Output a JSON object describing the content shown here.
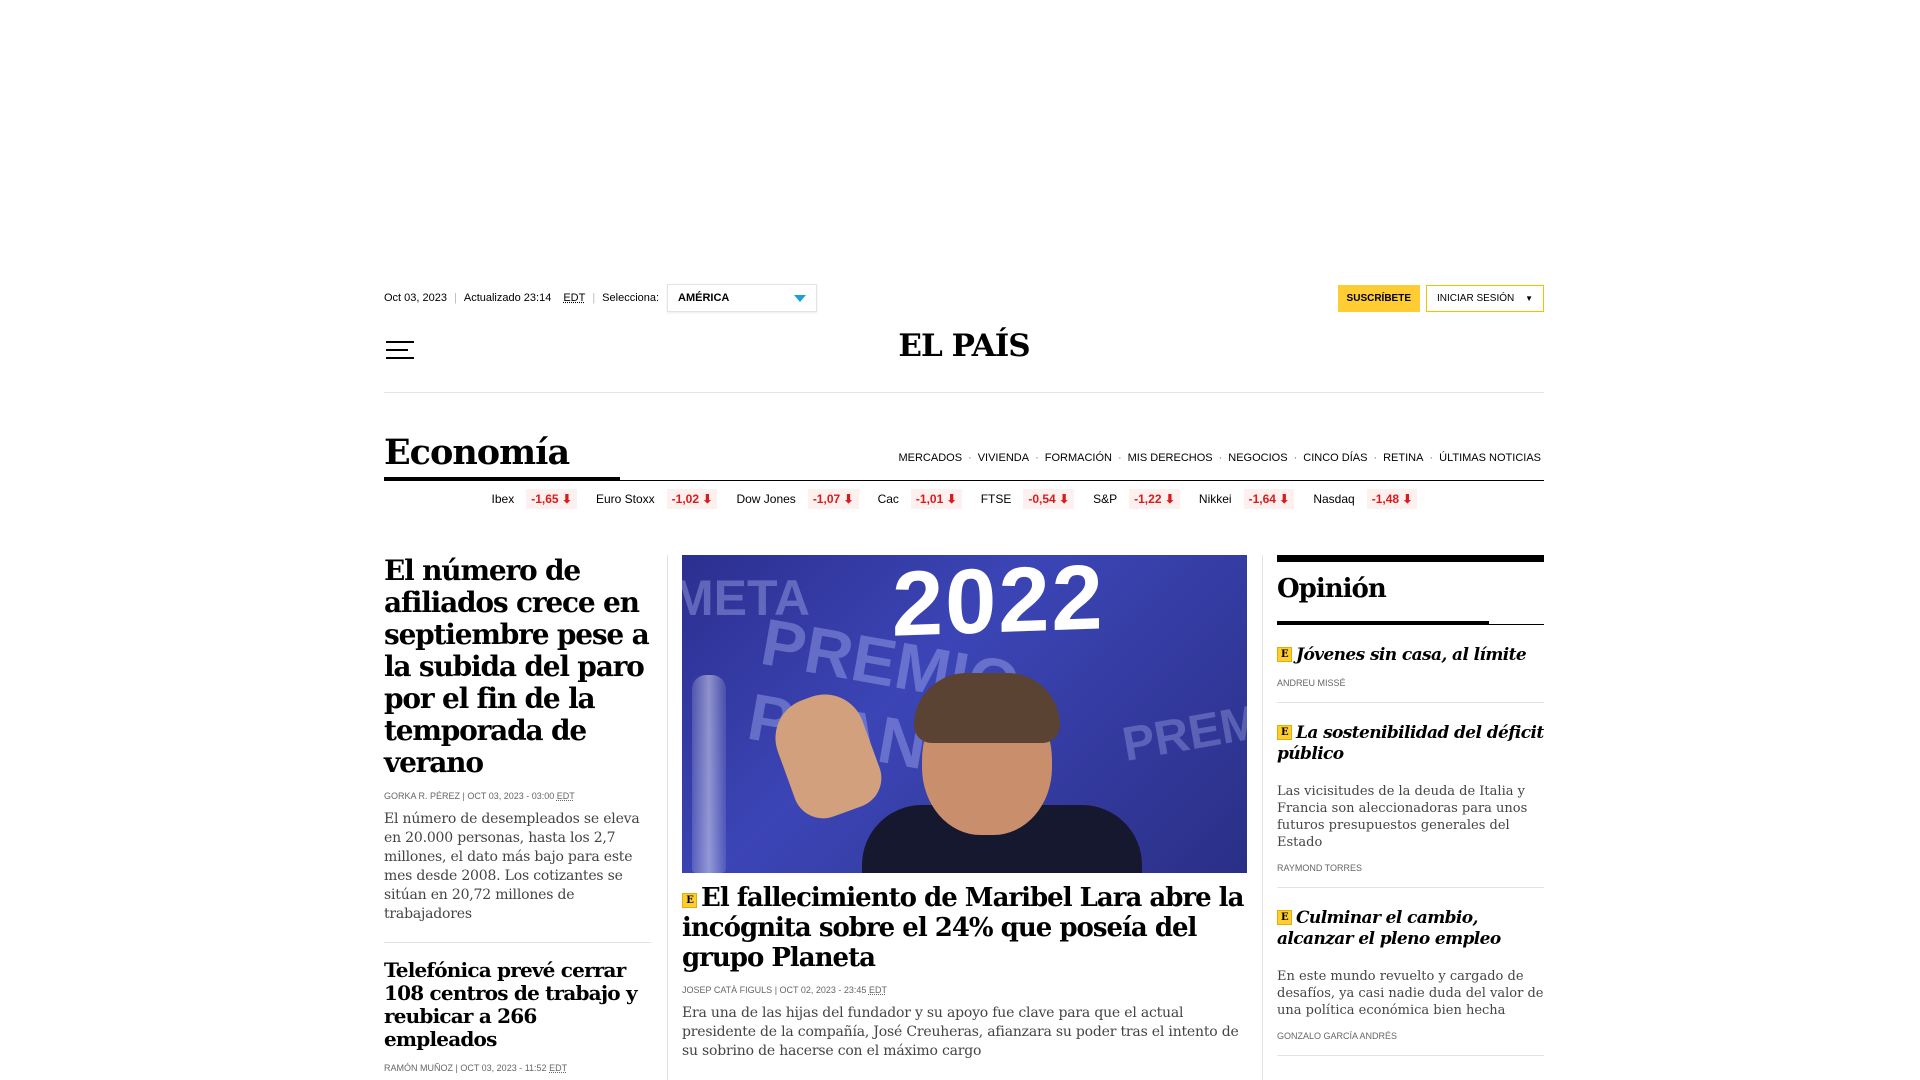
{
  "topbar": {
    "date": "Oct 03, 2023",
    "updated": "Actualizado 23:14",
    "tz": "EDT",
    "select_label": "Selecciona:",
    "region": "AMÉRICA",
    "subscribe": "SUSCRÍBETE",
    "login": "INICIAR SESIÓN"
  },
  "logo": "EL PAÍS",
  "section": {
    "title": "Economía",
    "nav": [
      "MERCADOS",
      "VIVIENDA",
      "FORMACIÓN",
      "MIS DERECHOS",
      "NEGOCIOS",
      "CINCO DÍAS",
      "RETINA",
      "ÚLTIMAS NOTICIAS"
    ]
  },
  "markets": [
    {
      "name": "Ibex",
      "value": "-1,65"
    },
    {
      "name": "Euro Stoxx",
      "value": "-1,02"
    },
    {
      "name": "Dow Jones",
      "value": "-1,07"
    },
    {
      "name": "Cac",
      "value": "-1,01"
    },
    {
      "name": "FTSE",
      "value": "-0,54"
    },
    {
      "name": "S&P",
      "value": "-1,22"
    },
    {
      "name": "Nikkei",
      "value": "-1,64"
    },
    {
      "name": "Nasdaq",
      "value": "-1,48"
    }
  ],
  "left": {
    "main": {
      "headline": "El número de afiliados crece en septiembre pese a la subida del paro por el fin de la temporada de verano",
      "byline": "GORKA R. PÉREZ | OCT 03, 2023 - 03:00",
      "tz": "EDT",
      "summary": "El número de desempleados se eleva en 20.000 personas, hasta los 2,7 millones, el dato más bajo para este mes desde 2008. Los cotizantes se sitúan en 20,72 millones de trabajadores"
    },
    "second": {
      "headline": "Telefónica prevé cerrar 108 centros de trabajo y reubicar a 266 empleados",
      "byline": "RAMÓN MUÑOZ | OCT 03, 2023 - 11:52",
      "tz": "EDT"
    }
  },
  "center": {
    "photo_text": "2022",
    "photo_bg_1": "META",
    "photo_bg_2": "PREMIO PLANETA",
    "photo_bg_3": "PREMI",
    "badge": "E",
    "headline": "El fallecimiento de Maribel Lara abre la incógnita sobre el 24% que poseía del grupo Planeta",
    "byline": "JOSEP CATÀ FIGULS | OCT 02, 2023 - 23:45",
    "tz": "EDT",
    "summary": "Era una de las hijas del fundador y su apoyo fue clave para que el actual presidente de la compañía, José Creuheras, afianzara su poder tras el intento de su sobrino de hacerse con el máximo cargo"
  },
  "opinion": {
    "title": "Opinión",
    "items": [
      {
        "badge": "E",
        "headline": "Jóvenes sin casa, al límite",
        "summary": "",
        "author": "ANDREU MISSÉ"
      },
      {
        "badge": "E",
        "headline": "La sostenibilidad del déficit público",
        "summary": "Las vicisitudes de la deuda de Italia y Francia son aleccionadoras para unos futuros presupuestos generales del Estado",
        "author": "RAYMOND TORRES"
      },
      {
        "badge": "E",
        "headline": "Culminar el cambio, alcanzar el pleno empleo",
        "summary": "En este mundo revuelto y cargado de desafíos, ya casi nadie duda del valor de una política económica bien hecha",
        "author": "GONZALO GARCÍA ANDRÉS"
      }
    ]
  },
  "colors": {
    "accent": "#ffcc33",
    "negative": "#d81b1b",
    "dropdown": "#1a9fd8"
  }
}
